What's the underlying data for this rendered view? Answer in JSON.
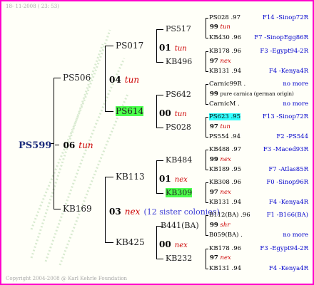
{
  "header": "18- 11-2008 ( 23: 53)",
  "footer": "Copyright 2004-2008 @ Karl Kehrle Foundation",
  "root": {
    "name": "PS599",
    "num": "06",
    "year": "tun"
  },
  "gen1": [
    {
      "name": "PS506"
    },
    {
      "name": "KB169"
    }
  ],
  "gen1_years": [
    {
      "num": "04",
      "year": "tun"
    },
    {
      "num": "03",
      "year": "nex"
    }
  ],
  "gen2": [
    {
      "name": "PS017"
    },
    {
      "name": "PS614"
    },
    {
      "name": "KB113"
    },
    {
      "name": "KB425"
    }
  ],
  "gen2_years": [
    {
      "num": "01",
      "year": "tun"
    },
    {
      "num": "00",
      "year": "tun"
    },
    {
      "num": "01",
      "year": "nex"
    },
    {
      "num": "00",
      "year": "nex"
    }
  ],
  "sister_colonies": "(12 sister colonies)",
  "gen3": [
    {
      "name": "PS517"
    },
    {
      "name": "KB496"
    },
    {
      "name": "PS642"
    },
    {
      "name": "PS028"
    },
    {
      "name": "KB484"
    },
    {
      "name": "KB309"
    },
    {
      "name": "B441(BA)"
    },
    {
      "name": "KB232"
    }
  ],
  "gen3_years": [
    {
      "num": "99",
      "year": "tun"
    },
    {
      "num": "97",
      "year": "nex"
    },
    {
      "num": "99",
      "year": "pure carnica (german origin)"
    },
    {
      "num": "97",
      "year": "tun"
    },
    {
      "num": "99",
      "year": "nex"
    },
    {
      "num": "97",
      "year": "nex"
    },
    {
      "num": "99",
      "year": "shr"
    },
    {
      "num": "97",
      "year": "nex"
    }
  ],
  "gen4": [
    {
      "name": "PS028 .97",
      "origin": "F14 -Sinop72R"
    },
    {
      "name": "KB430 .96",
      "origin": "F7 -SinopEgg86R"
    },
    {
      "name": "KB178 .96",
      "origin": "F3 -Egypt94-2R"
    },
    {
      "name": "KB131 .94",
      "origin": "F4 -Kenya4R"
    },
    {
      "name": "CarnicM .",
      "origin": "no more"
    },
    {
      "name": "CarnicM .",
      "origin": "no more"
    },
    {
      "name": "PS623 .95",
      "origin": "F13 -Sinop72R"
    },
    {
      "name": "PS554 .94",
      "origin": "F2 -PS544"
    },
    {
      "name": "KB488 .97",
      "origin": "F3 -Maced93R"
    },
    {
      "name": "KB189 .95",
      "origin": "F7 -Atlas85R"
    },
    {
      "name": "KB308 .96",
      "origin": "F0 -Sinop96R"
    },
    {
      "name": "KB131 .94",
      "origin": "F4 -Kenya4R"
    },
    {
      "name": "B112(BA) .96",
      "origin": "F1 -B166(BA)"
    },
    {
      "name": "B059(BA) .",
      "origin": "no more"
    },
    {
      "name": "KB178 .96",
      "origin": "F3 -Egypt94-2R"
    },
    {
      "name": "KB131 .94",
      "origin": "F4 -Kenya4R"
    }
  ],
  "gen4_first_label": "Carnic99R ."
}
